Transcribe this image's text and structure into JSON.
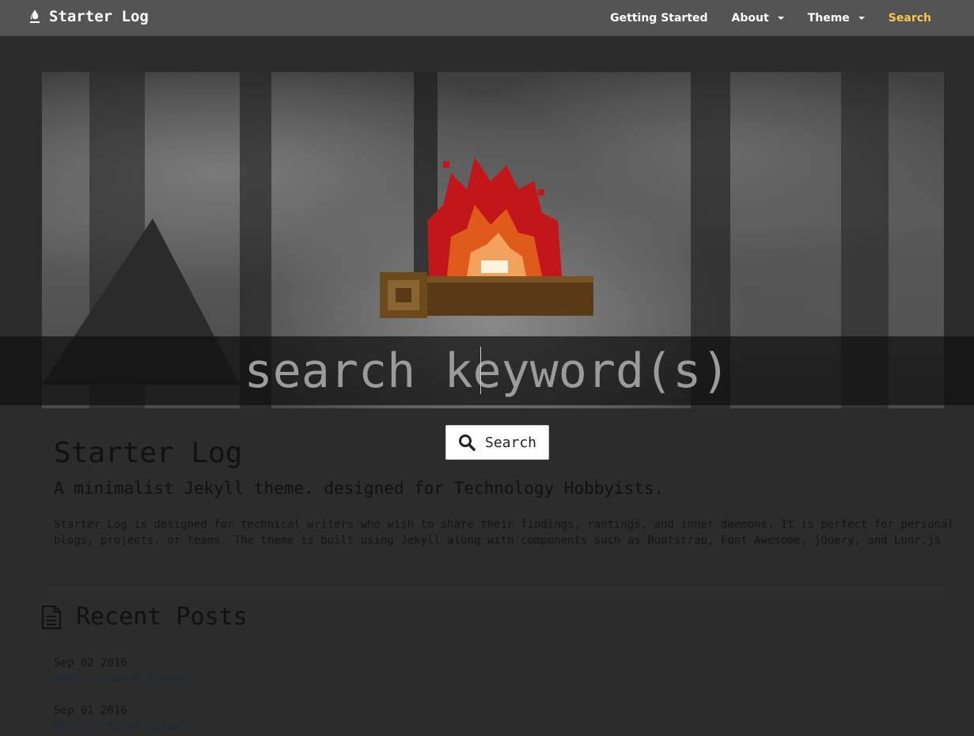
{
  "navbar": {
    "brand": "Starter Log",
    "brand_icon": "fire-icon",
    "items": [
      {
        "label": "Getting Started",
        "dropdown": false
      },
      {
        "label": "About",
        "dropdown": true
      },
      {
        "label": "Theme",
        "dropdown": true
      },
      {
        "label": "Search",
        "dropdown": false,
        "active": true
      }
    ],
    "active_color": "#f5c94b"
  },
  "search": {
    "placeholder": "search keyword(s)",
    "button_label": "Search",
    "button_icon": "search-icon"
  },
  "page": {
    "title": "Starter Log",
    "tagline": "A minimalist Jekyll theme. designed for Technology Hobbyists.",
    "description_line1": "Starter Log is designed for technical writers who wish to share their findings, rantings, and inner daemons. It is perfect for personal",
    "description_line2": "blogs, projects, or teams. The theme is built using Jekyll along with components such as Bootstrap, Font Awesome, jQuery, and Lunr.js"
  },
  "recent_posts": {
    "heading": "Recent Posts",
    "icon": "document-icon",
    "posts": [
      {
        "date": "Sep 02 2016",
        "title": "What is Lorem Ipsum?"
      },
      {
        "date": "Sep 01 2016",
        "title": "What is Bacon Ipsum?"
      }
    ]
  }
}
